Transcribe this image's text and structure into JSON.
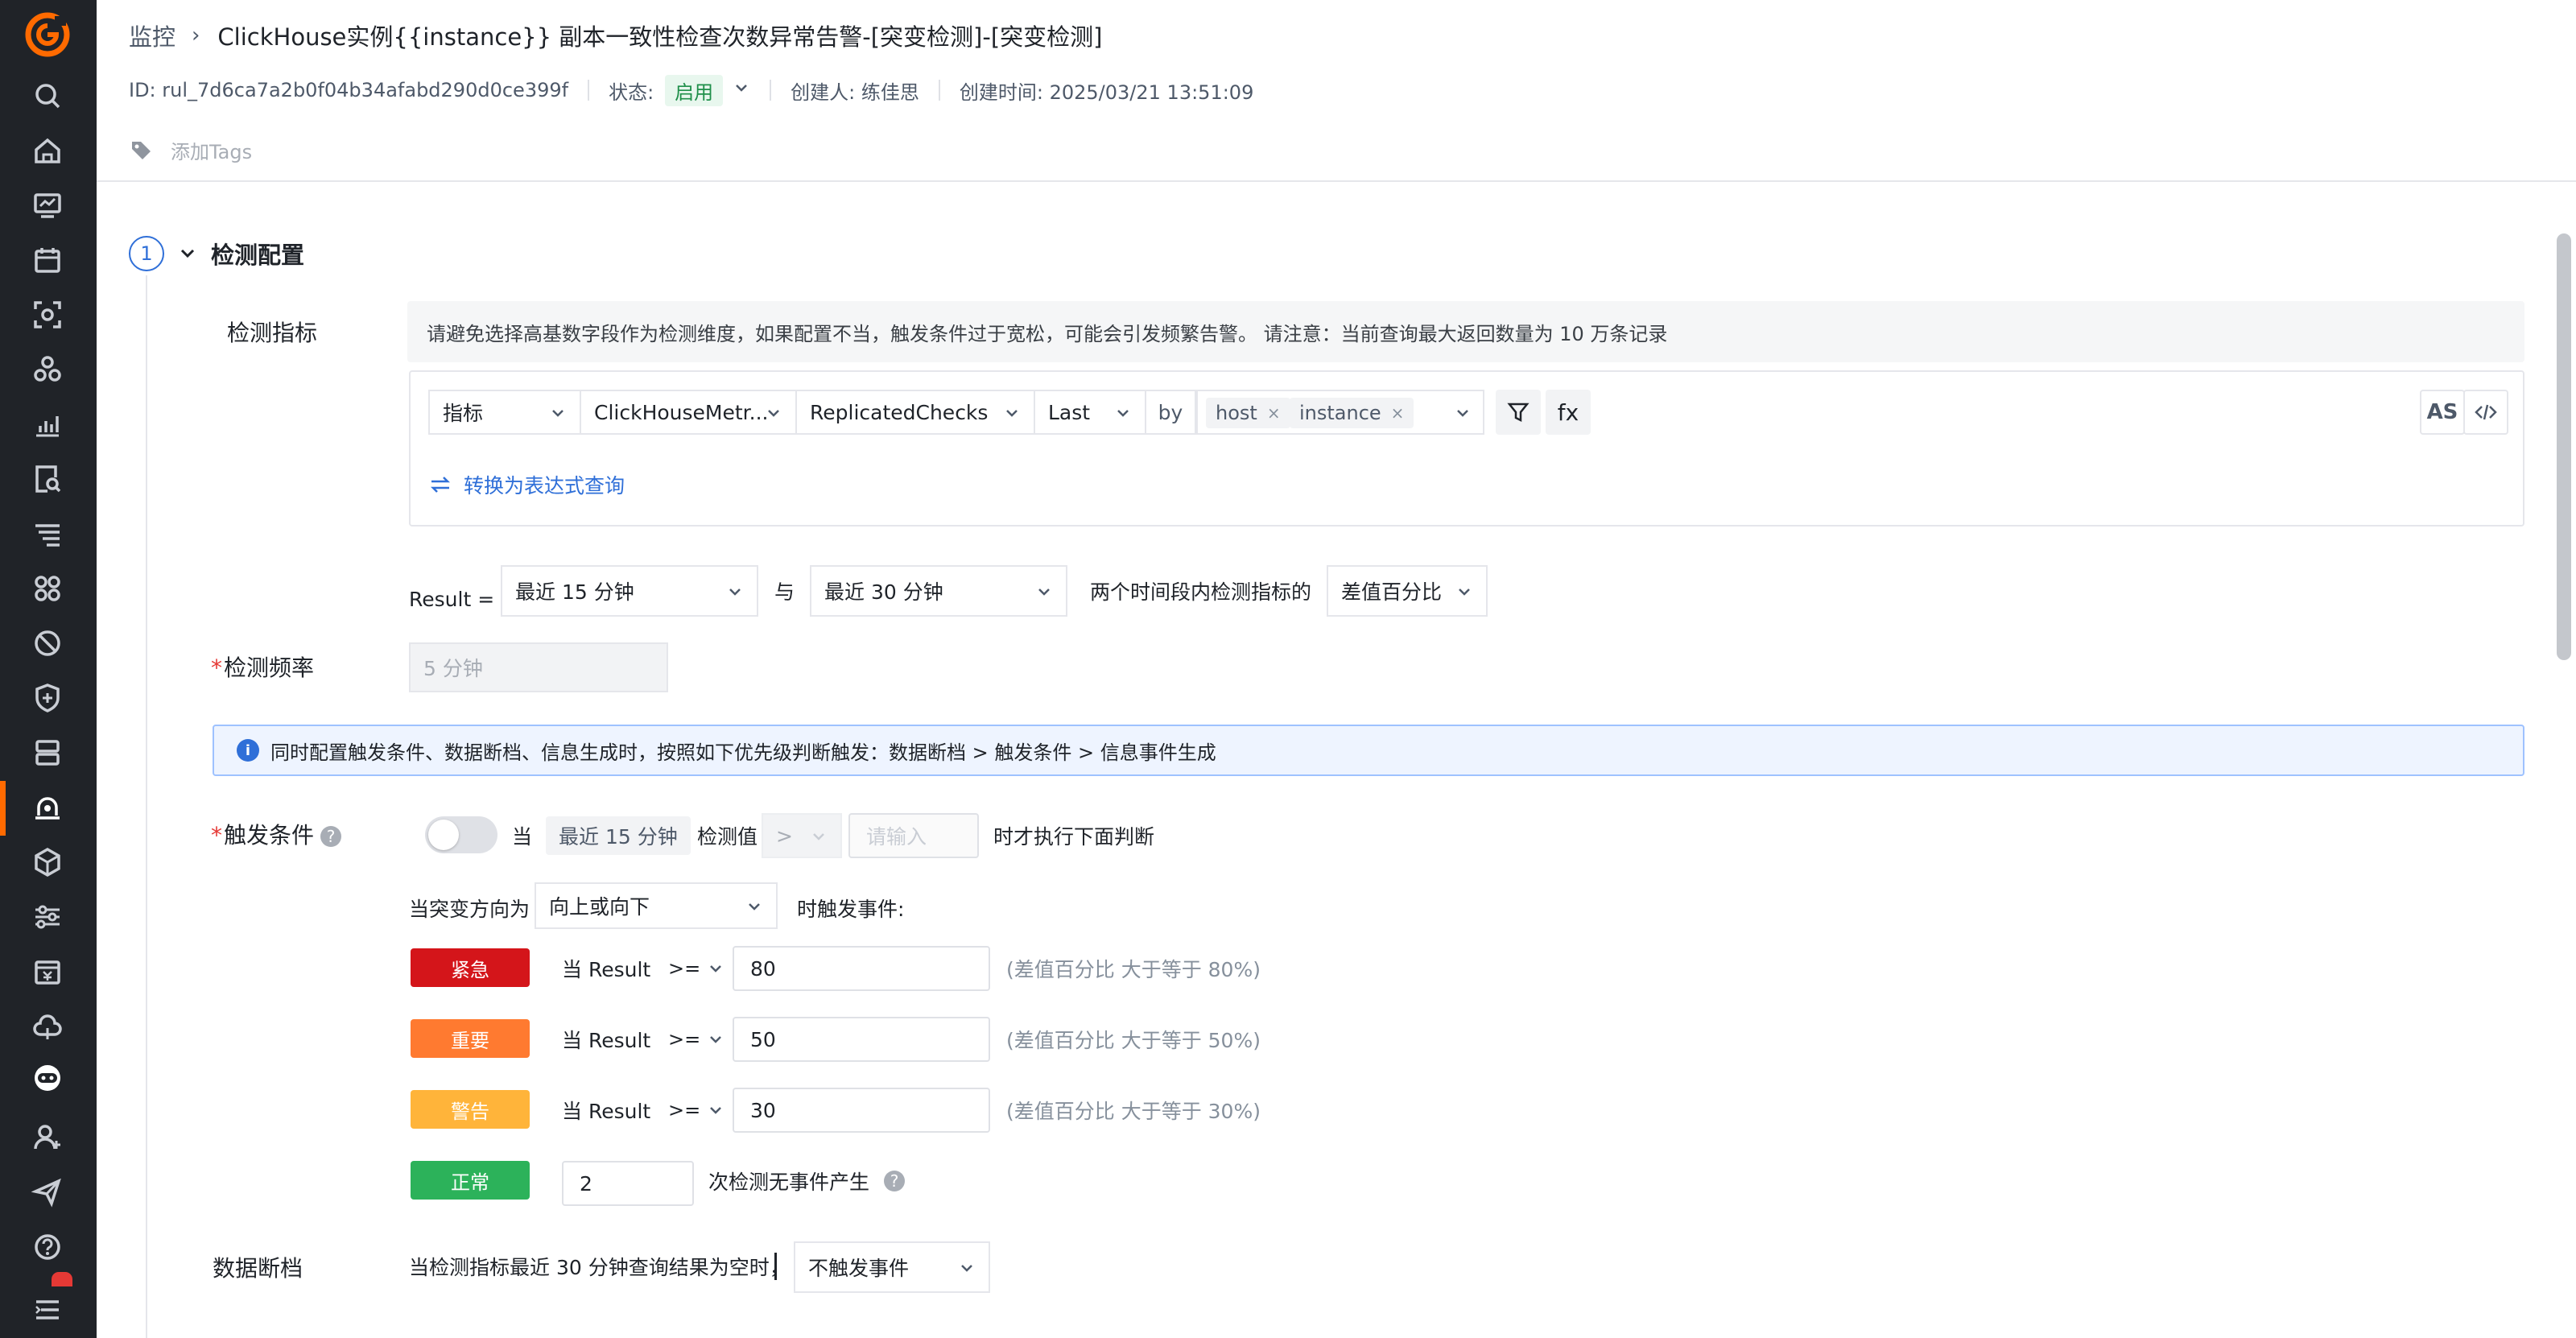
{
  "colors": {
    "rail_bg": "#202328",
    "brand": "#ff6a00",
    "link": "#2f6fd8",
    "critical": "#d4151a",
    "major": "#ff7a30",
    "warning": "#ffb43a",
    "normal": "#2cb25a"
  },
  "rail": {
    "icons": [
      "logo-icon",
      "search-icon",
      "home-icon",
      "monitor-icon",
      "calendar-icon",
      "scan-icon",
      "cluster-icon",
      "analytics-icon",
      "log-search-icon",
      "filter-list-icon",
      "apps-grid-icon",
      "no-entry-icon",
      "shield-icon",
      "server-icon",
      "alarm-monitor-icon",
      "cube-icon",
      "sliders-icon",
      "billing-icon",
      "cloud-icon",
      "robot-icon",
      "user-add-icon",
      "send-icon",
      "help-icon",
      "menu-icon"
    ],
    "active": "alarm-monitor-icon"
  },
  "header": {
    "breadcrumb_root": "监控",
    "breadcrumb_sep": "›",
    "title": "ClickHouse实例{{instance}} 副本一致性检查次数异常告警-[突变检测]-[突变检测]",
    "id_text": "ID: rul_7d6ca7a2b0f04b34afabd290d0ce399f",
    "status_label": "状态:",
    "status_value": "启用",
    "creator": "创建人: 练佳思",
    "created_at": "创建时间: 2025/03/21 13:51:09",
    "add_tags": "添加Tags"
  },
  "step": {
    "number": "1",
    "title": "检测配置"
  },
  "metric": {
    "label": "检测指标",
    "hint": "请避免选择高基数字段作为检测维度，如果配置不当，触发条件过于宽松，可能会引发频繁告警。 请注意：当前查询最大返回数量为 10 万条记录",
    "source": "指标",
    "measurement": "ClickHouseMetr...",
    "field": "ReplicatedChecks",
    "aggregation": "Last",
    "by_label": "by",
    "group_by": [
      "host",
      "instance"
    ],
    "tag_close": "×",
    "fx_label": "fx",
    "as_label": "AS",
    "convert_link": "转换为表达式查询"
  },
  "result": {
    "prefix": "Result =",
    "range1": "最近 15 分钟",
    "and": "与",
    "range2": "最近 30 分钟",
    "middle": "两个时间段内检测指标的",
    "method": "差值百分比"
  },
  "frequency": {
    "label": "检测频率",
    "value": "5 分钟"
  },
  "priority_info": "同时配置触发条件、数据断档、信息生成时，按照如下优先级判断触发：数据断档 > 触发条件 > 信息事件生成",
  "trigger": {
    "label": "触发条件",
    "when": "当",
    "range": "最近 15 分钟",
    "detect_value": "检测值",
    "op": ">",
    "placeholder": "请输入",
    "after": "时才执行下面判断",
    "direction_label": "当突变方向为",
    "direction": "向上或向下",
    "fire_label": "时触发事件:",
    "levels": [
      {
        "name": "紧急",
        "when": "当 Result",
        "op": ">=",
        "value": "80",
        "desc": "(差值百分比 大于等于 80%)"
      },
      {
        "name": "重要",
        "when": "当 Result",
        "op": ">=",
        "value": "50",
        "desc": "(差值百分比 大于等于 50%)"
      },
      {
        "name": "警告",
        "when": "当 Result",
        "op": ">=",
        "value": "30",
        "desc": "(差值百分比 大于等于 30%)"
      }
    ],
    "normal": {
      "name": "正常",
      "value": "2",
      "desc": "次检测无事件产生"
    }
  },
  "nodata": {
    "label": "数据断档",
    "text": "当检测指标最近 30 分钟查询结果为空时，",
    "action": "不触发事件"
  }
}
